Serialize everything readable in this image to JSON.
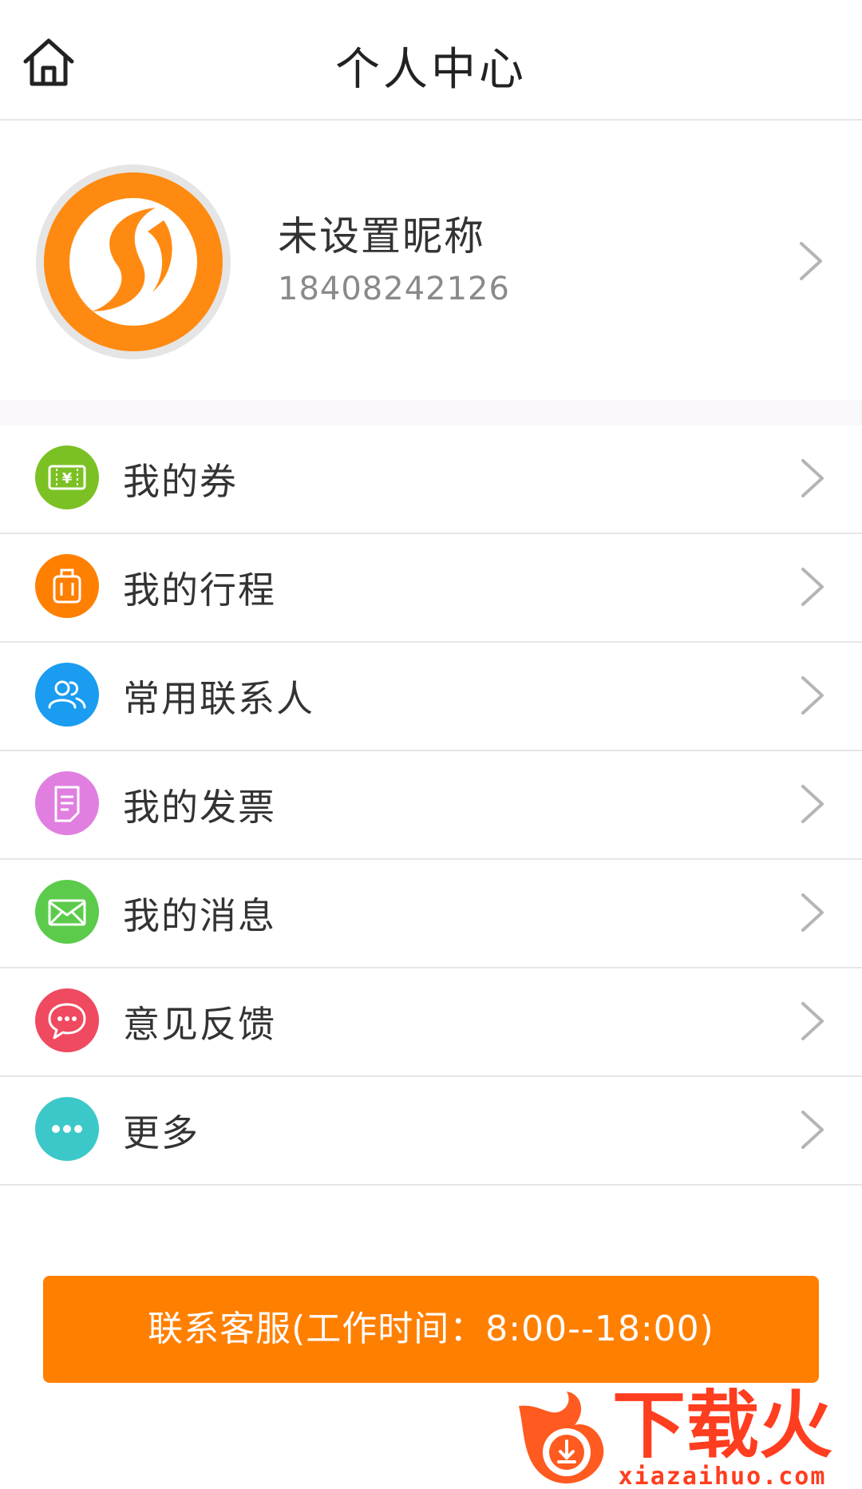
{
  "header": {
    "title": "个人中心"
  },
  "profile": {
    "nickname": "未设置昵称",
    "phone": "18408242126"
  },
  "menu": {
    "items": [
      {
        "label": "我的券",
        "icon": "coupon-icon",
        "color": "#7bc124"
      },
      {
        "label": "我的行程",
        "icon": "luggage-icon",
        "color": "#ff7f00"
      },
      {
        "label": "常用联系人",
        "icon": "contacts-icon",
        "color": "#1a9cf0"
      },
      {
        "label": "我的发票",
        "icon": "invoice-icon",
        "color": "#e07fe0"
      },
      {
        "label": "我的消息",
        "icon": "mail-icon",
        "color": "#5ccb4c"
      },
      {
        "label": "意见反馈",
        "icon": "chat-icon",
        "color": "#ef4a60"
      },
      {
        "label": "更多",
        "icon": "more-icon",
        "color": "#3cc8c8"
      }
    ]
  },
  "contact_button": {
    "label": "联系客服(工作时间：8:00--18:00)"
  },
  "watermark": {
    "text": "下载火",
    "domain": "xiazaihuo.com"
  },
  "colors": {
    "accent": "#ff7f00",
    "divider": "#e6e6e6"
  }
}
